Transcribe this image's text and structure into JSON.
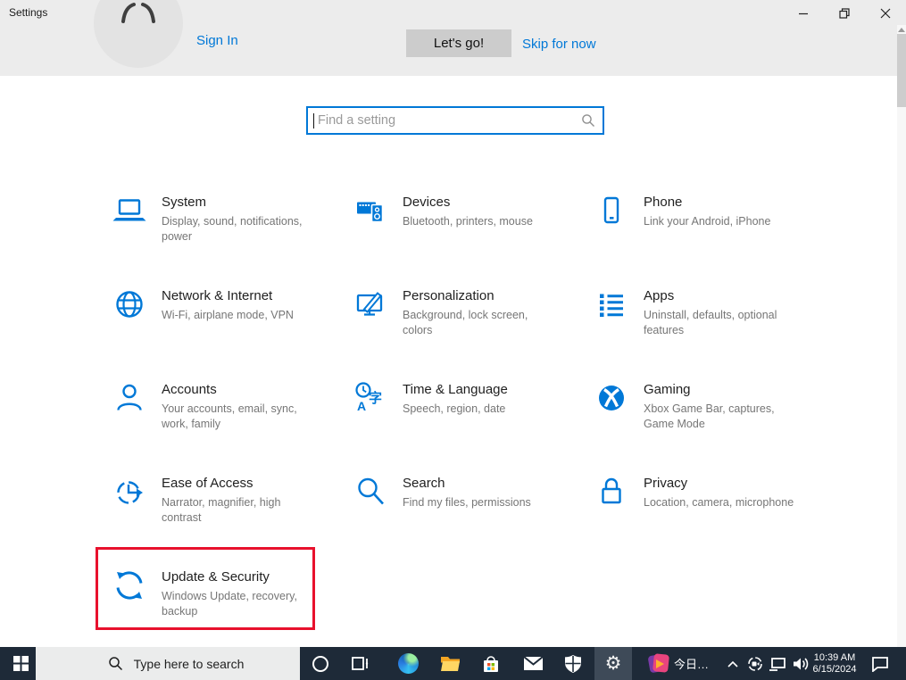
{
  "window": {
    "title": "Settings"
  },
  "header": {
    "sign_in": "Sign In",
    "lets_go": "Let's go!",
    "skip": "Skip for now"
  },
  "search": {
    "placeholder": "Find a setting"
  },
  "tiles": [
    {
      "name": "system",
      "title": "System",
      "subtitle": "Display, sound, notifications, power"
    },
    {
      "name": "devices",
      "title": "Devices",
      "subtitle": "Bluetooth, printers, mouse"
    },
    {
      "name": "phone",
      "title": "Phone",
      "subtitle": "Link your Android, iPhone"
    },
    {
      "name": "network-internet",
      "title": "Network & Internet",
      "subtitle": "Wi-Fi, airplane mode, VPN"
    },
    {
      "name": "personalization",
      "title": "Personalization",
      "subtitle": "Background, lock screen, colors"
    },
    {
      "name": "apps",
      "title": "Apps",
      "subtitle": "Uninstall, defaults, optional features"
    },
    {
      "name": "accounts",
      "title": "Accounts",
      "subtitle": "Your accounts, email, sync, work, family"
    },
    {
      "name": "time-language",
      "title": "Time & Language",
      "subtitle": "Speech, region, date"
    },
    {
      "name": "gaming",
      "title": "Gaming",
      "subtitle": "Xbox Game Bar, captures, Game Mode"
    },
    {
      "name": "ease-of-access",
      "title": "Ease of Access",
      "subtitle": "Narrator, magnifier, high contrast"
    },
    {
      "name": "search",
      "title": "Search",
      "subtitle": "Find my files, permissions"
    },
    {
      "name": "privacy",
      "title": "Privacy",
      "subtitle": "Location, camera, microphone"
    },
    {
      "name": "update-security",
      "title": "Update & Security",
      "subtitle": "Windows Update, recovery, backup"
    }
  ],
  "highlight": {
    "target": "update-security",
    "color": "#e8112d"
  },
  "taskbar": {
    "search_placeholder": "Type here to search",
    "today_label": "今日…",
    "clock": {
      "time": "10:39 AM",
      "date": "6/15/2024"
    }
  },
  "colors": {
    "accent": "#0078d7",
    "header_strip": "#ececec",
    "taskbar_bg": "#1e2a38",
    "subtitle_gray": "#767676"
  }
}
